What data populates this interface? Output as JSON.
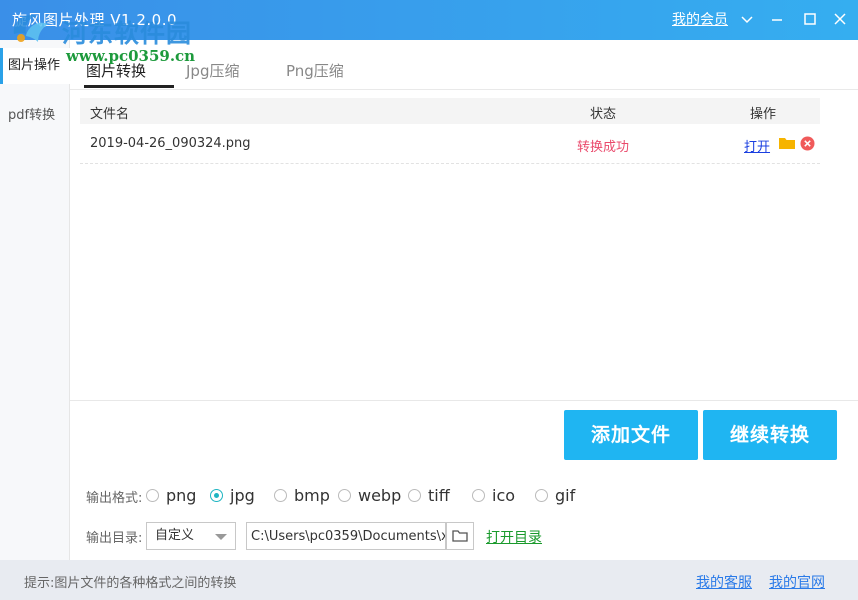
{
  "window": {
    "title": "旋风图片处理 V1.2.0.0",
    "member_link": "我的会员",
    "watermark": "河东软件园",
    "watermark_url": "www.pc0359.cn"
  },
  "sidebar": {
    "items": [
      {
        "label": "图片操作",
        "active": true
      },
      {
        "label": "pdf转换",
        "active": false
      }
    ]
  },
  "tabs": [
    {
      "label": "图片转换",
      "active": true
    },
    {
      "label": "Jpg压缩",
      "active": false
    },
    {
      "label": "Png压缩",
      "active": false
    }
  ],
  "table": {
    "headers": {
      "filename": "文件名",
      "status": "状态",
      "action": "操作"
    },
    "rows": [
      {
        "filename": "2019-04-26_090324.png",
        "status": "转换成功",
        "action_open": "打开"
      }
    ]
  },
  "buttons": {
    "add_file": "添加文件",
    "continue_convert": "继续转换"
  },
  "output_format": {
    "label": "输出格式:",
    "options": [
      "png",
      "jpg",
      "bmp",
      "webp",
      "tiff",
      "ico",
      "gif"
    ],
    "selected": "jpg"
  },
  "output_dir": {
    "label": "输出目录:",
    "mode": "自定义",
    "path": "C:\\Users\\pc0359\\Documents\\x",
    "open_dir": "打开目录"
  },
  "statusbar": {
    "hint": "提示:图片文件的各种格式之间的转换",
    "support_link": "我的客服",
    "website_link": "我的官网"
  },
  "colors": {
    "titlebar": "#3a8fe8",
    "accent_button": "#1fb5f2",
    "status_success": "#ea4a6c",
    "link_blue": "#2a7ae8",
    "link_green": "#1a9a2c"
  }
}
